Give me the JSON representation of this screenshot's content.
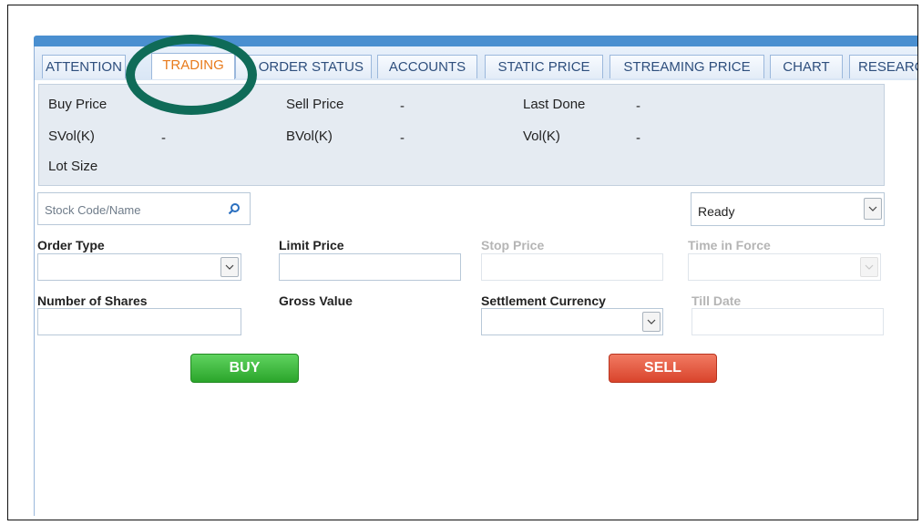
{
  "tabs": [
    {
      "label": "ATTENTION"
    },
    {
      "label": "TRADING"
    },
    {
      "label": "ORDER STATUS"
    },
    {
      "label": "ACCOUNTS"
    },
    {
      "label": "STATIC PRICE"
    },
    {
      "label": "STREAMING PRICE"
    },
    {
      "label": "CHART"
    },
    {
      "label": "RESEARCH"
    }
  ],
  "active_tab": "TRADING",
  "quote": {
    "buy_price_label": "Buy Price",
    "sell_price_label": "Sell Price",
    "sell_price_value": "-",
    "last_done_label": "Last Done",
    "last_done_value": "-",
    "svol_label": "SVol(K)",
    "svol_value": "-",
    "bvol_label": "BVol(K)",
    "bvol_value": "-",
    "vol_label": "Vol(K)",
    "vol_value": "-",
    "lot_size_label": "Lot Size"
  },
  "search": {
    "placeholder": "Stock Code/Name"
  },
  "status_select": {
    "value": "Ready"
  },
  "order_form": {
    "order_type_label": "Order Type",
    "limit_price_label": "Limit Price",
    "stop_price_label": "Stop Price",
    "time_in_force_label": "Time in Force",
    "number_of_shares_label": "Number of Shares",
    "gross_value_label": "Gross Value",
    "settlement_currency_label": "Settlement Currency",
    "till_date_label": "Till Date"
  },
  "buttons": {
    "buy": "BUY",
    "sell": "SELL"
  },
  "colors": {
    "accent_blue": "#4a8fd0",
    "active_tab_text": "#e87b1c",
    "buy_green": "#2ba52b",
    "sell_red": "#d9442c",
    "highlight_ring": "#0f6b58"
  }
}
